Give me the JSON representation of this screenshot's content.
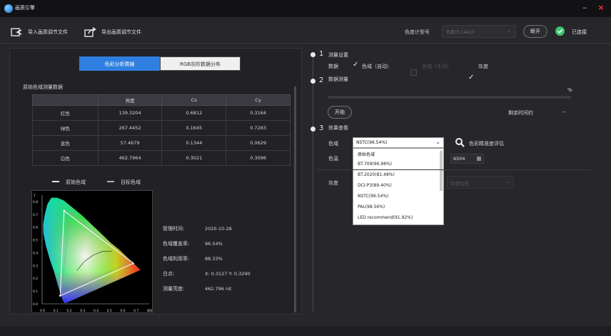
{
  "app": {
    "title": "画质引擎",
    "minimize_glyph": "–",
    "close_glyph": "×"
  },
  "toolbar": {
    "import_label": "导入画质调节文件",
    "export_label": "导出画质调节文件",
    "meter_label": "色度计型号",
    "meter_value": "色度计-CA410",
    "disconnect_label": "断开",
    "connected_label": "已连接"
  },
  "tabs": [
    {
      "label": "色彩分析算据",
      "active": true
    },
    {
      "label": "RGB灰阶数据分布",
      "active": false
    }
  ],
  "measure_table": {
    "title": "原始色域测量数据",
    "headers": [
      "",
      "亮度",
      "Cx",
      "Cy"
    ],
    "rows": [
      [
        "红色",
        "139.3204",
        "0.6812",
        "0.3164"
      ],
      [
        "绿色",
        "267.4452",
        "0.1645",
        "0.7283"
      ],
      [
        "蓝色",
        "57.4679",
        "0.1344",
        "0.0629"
      ],
      [
        "白色",
        "462.7964",
        "0.3021",
        "0.3096"
      ]
    ]
  },
  "legend": {
    "original": "原始色域",
    "target": "目标色域"
  },
  "chart_data": {
    "type": "scatter",
    "title": "",
    "x_ticks": [
      "0.0",
      "0.1",
      "0.2",
      "0.3",
      "0.4",
      "0.5",
      "0.6",
      "0.7",
      "0.8"
    ],
    "y_ticks": [
      "0.0",
      "0.1",
      "0.2",
      "0.3",
      "0.4",
      "0.5",
      "0.6",
      "0.7",
      "0.8"
    ],
    "xlabel": "X",
    "ylabel": "Y",
    "series": [
      {
        "name": "原始色域",
        "x": [
          0.6812,
          0.1645,
          0.1344
        ],
        "y": [
          0.3164,
          0.7283,
          0.0629
        ]
      },
      {
        "name": "目标色域",
        "x": [
          0.67,
          0.21,
          0.14
        ],
        "y": [
          0.33,
          0.71,
          0.08
        ]
      }
    ],
    "white_point": {
      "x": 0.3127,
      "y": 0.329
    }
  },
  "info": [
    {
      "label": "管理时间:",
      "value": "2020-10-28"
    },
    {
      "label": "色域覆盖率:",
      "value": "96.54%"
    },
    {
      "label": "色域利用率:",
      "value": "88.33%"
    },
    {
      "label": "白点:",
      "value": "X: 0.3127  Y: 0.3290"
    },
    {
      "label": "测量亮度:",
      "value": "462.796 nit"
    }
  ],
  "steps": {
    "s1": {
      "num": "1",
      "title": "测量设置",
      "data_label": "数据",
      "opt_gamut_auto": "色域（自动）",
      "opt_gamut_manual": "色域（手动）",
      "opt_gray": "灰度"
    },
    "s2": {
      "num": "2",
      "title": "数据测量",
      "percent": "%",
      "start_label": "开始",
      "remaining_label": "剩余时间约",
      "remaining_value": "--"
    },
    "s3": {
      "num": "3",
      "title": "效果查看",
      "gamut_label": "色域",
      "gamut_selected": "NSTC(96.54%)",
      "gamut_options": [
        "原始色域",
        "BT.709(96.98%)",
        "BT.2020(81.48%)",
        "DCI-P3(89.40%)",
        "NSTC(96.54%)",
        "PAL(98.56%)",
        "LED recommend(91.92%)"
      ],
      "accuracy_label": "色彩精准度评估",
      "colortemp_label": "色温",
      "colortemp_value": "6504",
      "gray_label": "灰度",
      "gray_select": "灰度优先"
    }
  }
}
